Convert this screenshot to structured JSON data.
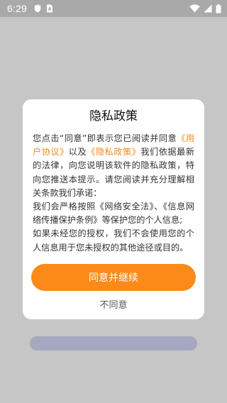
{
  "status_bar": {
    "time": "6:29",
    "left_icons": [
      "shield-icon",
      "sim-card-icon"
    ],
    "right_icons": [
      "wifi-icon",
      "signal-icon",
      "battery-icon"
    ]
  },
  "dialog": {
    "title": "隐私政策",
    "body": {
      "intro": "您点击“同意”即表示您已阅读并同意",
      "user_agreement_link": "《用户协议》",
      "conjunction": "以及",
      "privacy_policy_link": "《隐私政策》",
      "paragraph_rest": "我们依据最新的法律，向您说明该软件的隐私政策，特向您推送本提示。请您阅读并充分理解相关条款我们承诺：",
      "line_laws": "我们会严格按照《网络安全法》、《信息网络传播保护条例》等保护您的个人信息;",
      "line_authorization": "如果未经您的授权，我们不会使用您的个人信息用于您未授权的其他途径或目的。"
    },
    "agree_button_label": "同意并继续",
    "disagree_button_label": "不同意"
  },
  "colors": {
    "accent": "#fb8a18",
    "link": "#f08a1e",
    "overlay_background": "#c6c6c6",
    "status_bar": "#a9a9a9",
    "placeholder_bar": "#a5a8bf"
  }
}
